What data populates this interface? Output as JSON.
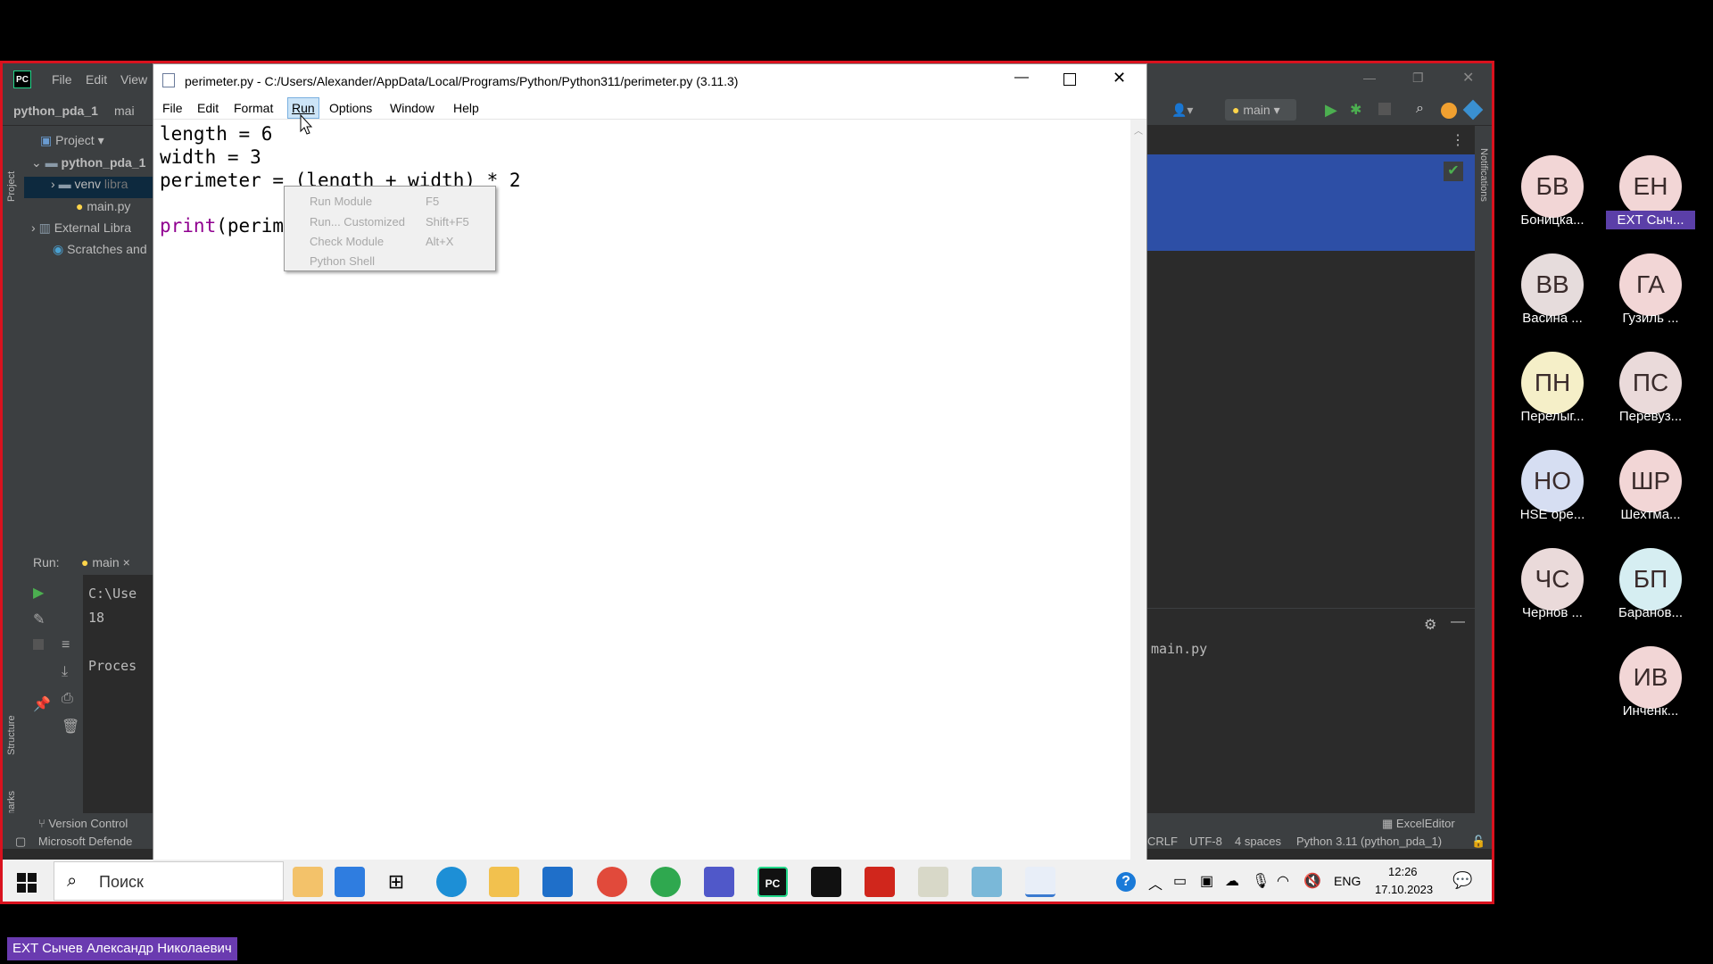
{
  "pycharm": {
    "logo": "PC",
    "menu": [
      "File",
      "Edit",
      "View"
    ],
    "project_name": "python_pda_1",
    "file_tab": "mai",
    "run_config": "main",
    "project_panel_title": "Project",
    "tree": [
      {
        "label": "python_pda_1"
      },
      {
        "label": "venv",
        "sub": "libra"
      },
      {
        "label": "main.py"
      },
      {
        "label": "External Libra"
      },
      {
        "label": "Scratches and"
      }
    ],
    "run_label": "Run:",
    "run_tab": "main",
    "run_output": [
      "C:\\Use",
      "18",
      "",
      "Proces"
    ],
    "right_run_output": "main.py",
    "side_tabs": {
      "project": "Project",
      "structure": "Structure",
      "bookmarks": "Bookmarks",
      "notifications": "Notifications"
    },
    "bottom_left": [
      "Version Control",
      "Microsoft Defende"
    ],
    "bottom_right_top": "ExcelEditor",
    "status": {
      "line_sep": "CRLF",
      "encoding": "UTF-8",
      "indent": "4 spaces",
      "interpreter": "Python 3.11 (python_pda_1)"
    }
  },
  "idle": {
    "title": "perimeter.py - C:/Users/Alexander/AppData/Local/Programs/Python/Python311/perimeter.py (3.11.3)",
    "menu": [
      "File",
      "Edit",
      "Format",
      "Run",
      "Options",
      "Window",
      "Help"
    ],
    "code": {
      "line1": "length = 6",
      "line2": "width = 3",
      "line3": "perimeter = (length + width) * 2",
      "line5_kw": "print",
      "line5_rest": "(perimeter)"
    },
    "run_menu": [
      {
        "label": "Run Module",
        "shortcut": "F5"
      },
      {
        "label": "Run... Customized",
        "shortcut": "Shift+F5"
      },
      {
        "label": "Check Module",
        "shortcut": "Alt+X"
      },
      {
        "label": "Python Shell",
        "shortcut": ""
      }
    ]
  },
  "taskbar": {
    "search_placeholder": "Поиск",
    "lang": "ENG",
    "time": "12:26",
    "date": "17.10.2023"
  },
  "participants": [
    {
      "initials": "БВ",
      "name": "Боницка...",
      "color": "#f2d6d6"
    },
    {
      "initials": "ЕН",
      "name": "EXT Сыч...",
      "color": "#f2d6d6",
      "active": true
    },
    {
      "initials": "ВВ",
      "name": "Васина ...",
      "color": "#e6dcdc"
    },
    {
      "initials": "ГА",
      "name": "Гузиль ...",
      "color": "#f2d6d6"
    },
    {
      "initials": "ПН",
      "name": "Перелыг...",
      "color": "#f5efc8"
    },
    {
      "initials": "ПС",
      "name": "Перевуз...",
      "color": "#eadada"
    },
    {
      "initials": "НО",
      "name": "HSE оре...",
      "color": "#d6def2"
    },
    {
      "initials": "ШР",
      "name": "Шехтма...",
      "color": "#f2d6d6"
    },
    {
      "initials": "ЧС",
      "name": "Чернов ...",
      "color": "#eadada"
    },
    {
      "initials": "БП",
      "name": "Баранов...",
      "color": "#d6eef2"
    },
    {
      "initials": "ИВ",
      "name": "Инченк...",
      "color": "#f2d6d6"
    }
  ],
  "speaker": "EXT Сычев Александр Николаевич"
}
